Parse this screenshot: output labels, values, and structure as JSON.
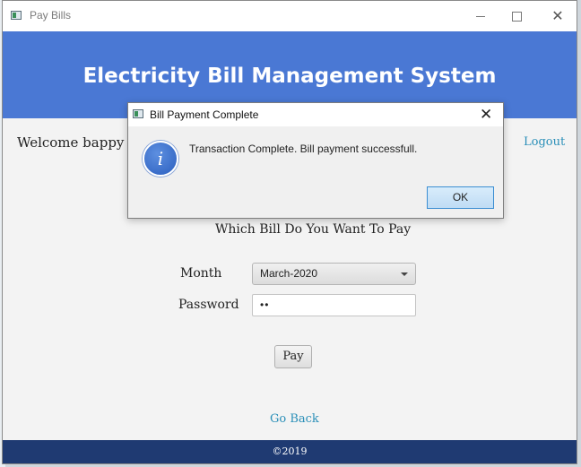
{
  "window": {
    "title": "Pay Bills",
    "minimize_icon": "minimize-icon",
    "maximize_icon": "maximize-icon",
    "close_icon": "close-icon",
    "close_glyph": "✕"
  },
  "header": {
    "title": "Electricity Bill Management System",
    "color": "#4a78d4"
  },
  "user": {
    "welcome": "Welcome bappy",
    "logout": "Logout"
  },
  "form": {
    "question": "Which Bill Do You Want To Pay",
    "month_label": "Month",
    "month_value": "March-2020",
    "password_label": "Password",
    "password_value": "••",
    "pay_button": "Pay"
  },
  "nav": {
    "go_back": "Go Back"
  },
  "footer": {
    "text": "©2019",
    "color": "#1f3a72"
  },
  "dialog": {
    "title": "Bill Payment Complete",
    "close_glyph": "✕",
    "icon": "info-icon",
    "icon_glyph": "i",
    "message": "Transaction Complete. Bill payment successfull.",
    "ok_button": "OK"
  },
  "colors": {
    "link": "#2a8fb8",
    "ok_border": "#3c8ed2"
  }
}
